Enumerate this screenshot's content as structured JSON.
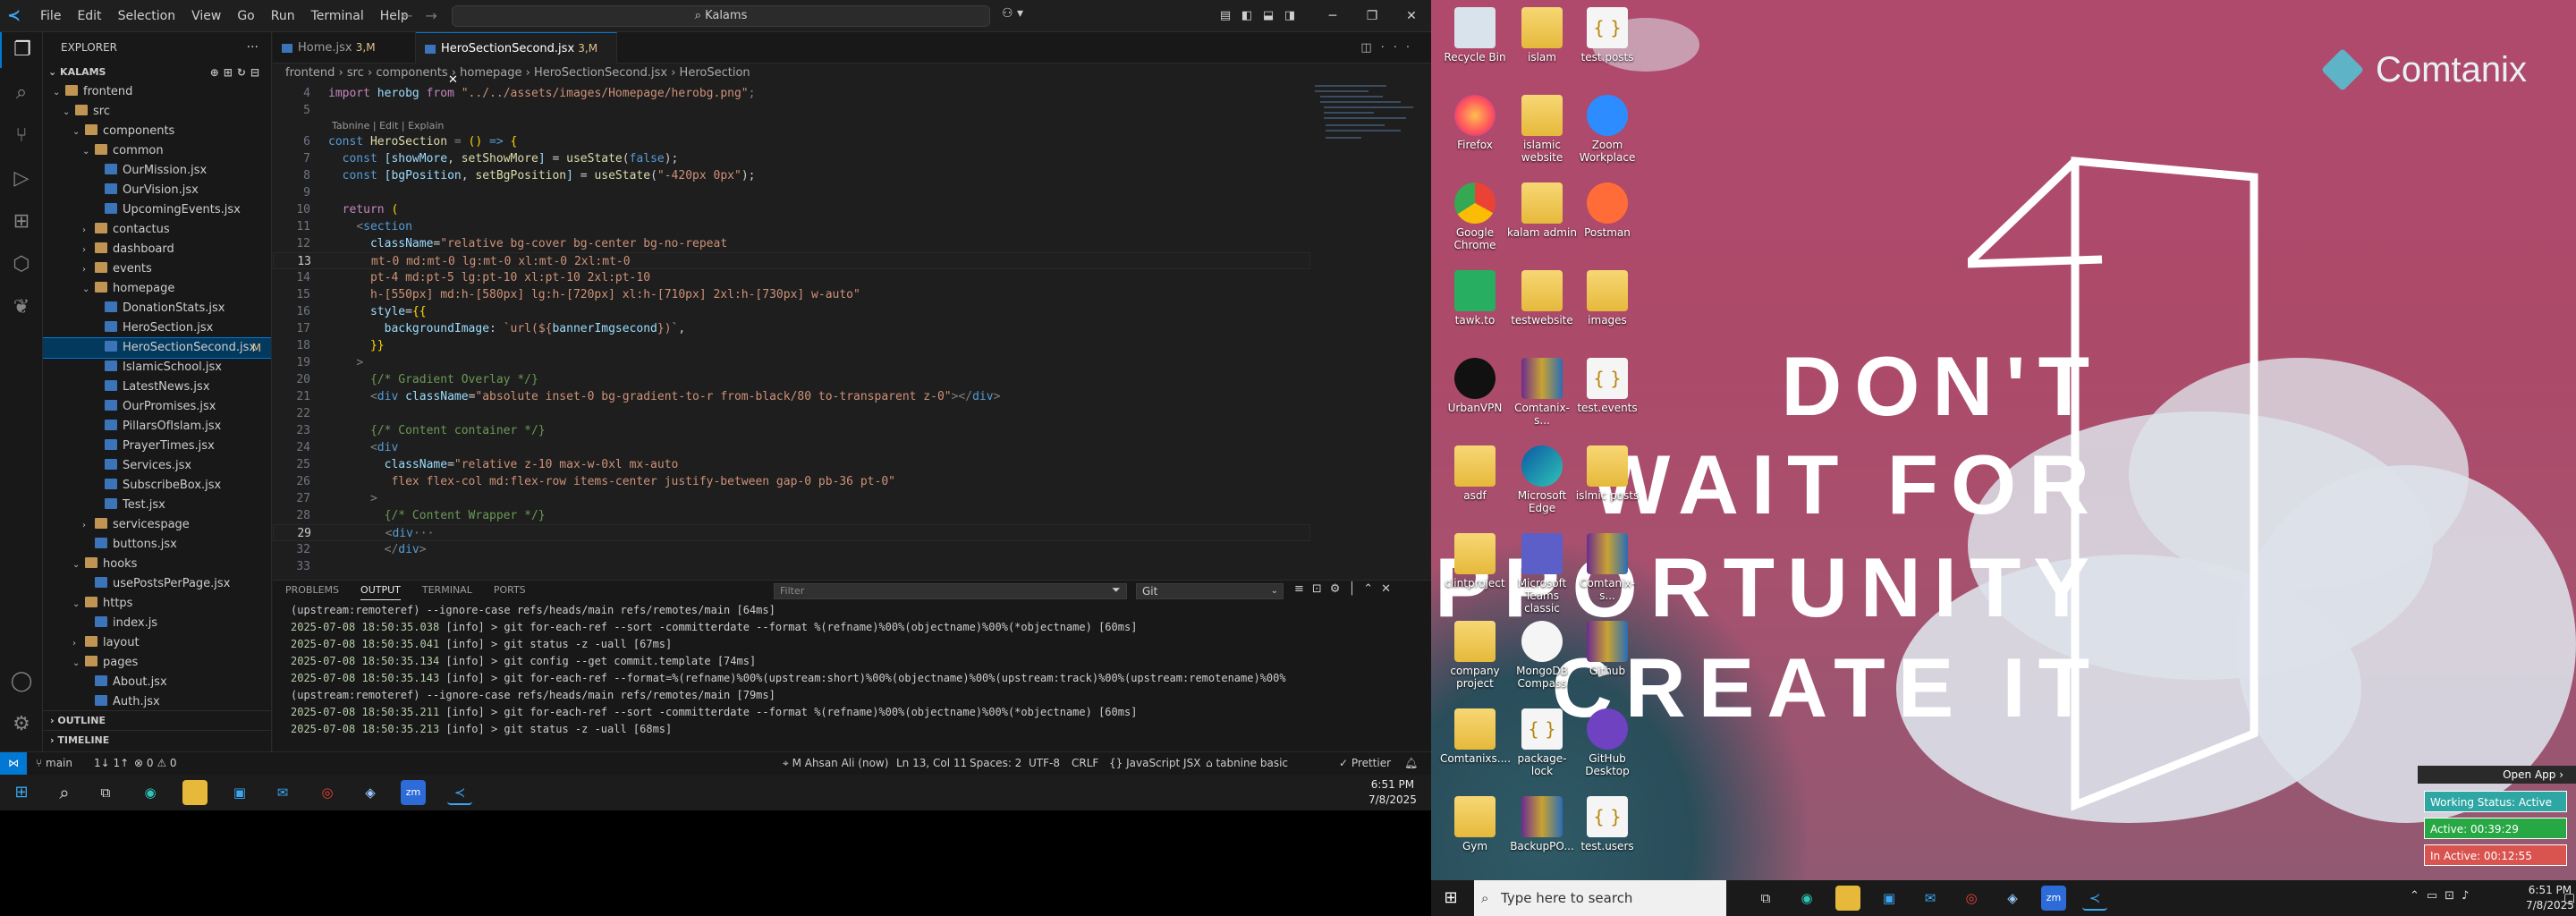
{
  "vscode": {
    "menu": [
      "File",
      "Edit",
      "Selection",
      "View",
      "Go",
      "Run",
      "Terminal",
      "Help"
    ],
    "search": "Kalams",
    "explorer_title": "EXPLORER",
    "root": "KALAMS",
    "tree": [
      {
        "label": "frontend",
        "type": "folder",
        "depth": 1,
        "open": true
      },
      {
        "label": "src",
        "type": "folder",
        "depth": 2,
        "open": true
      },
      {
        "label": "components",
        "type": "folder",
        "depth": 3,
        "open": true
      },
      {
        "label": "common",
        "type": "folder",
        "depth": 4,
        "open": true
      },
      {
        "label": "OurMission.jsx",
        "type": "file",
        "depth": 5
      },
      {
        "label": "OurVision.jsx",
        "type": "file",
        "depth": 5
      },
      {
        "label": "UpcomingEvents.jsx",
        "type": "file",
        "depth": 5
      },
      {
        "label": "contactus",
        "type": "folder",
        "depth": 4,
        "open": false
      },
      {
        "label": "dashboard",
        "type": "folder",
        "depth": 4,
        "open": false
      },
      {
        "label": "events",
        "type": "folder",
        "depth": 4,
        "open": false
      },
      {
        "label": "homepage",
        "type": "folder",
        "depth": 4,
        "open": true
      },
      {
        "label": "DonationStats.jsx",
        "type": "file",
        "depth": 5
      },
      {
        "label": "HeroSection.jsx",
        "type": "file",
        "depth": 5
      },
      {
        "label": "HeroSectionSecond.jsx",
        "type": "file",
        "depth": 5,
        "selected": true,
        "mod": "M"
      },
      {
        "label": "IslamicSchool.jsx",
        "type": "file",
        "depth": 5
      },
      {
        "label": "LatestNews.jsx",
        "type": "file",
        "depth": 5
      },
      {
        "label": "OurPromises.jsx",
        "type": "file",
        "depth": 5
      },
      {
        "label": "PillarsOfIslam.jsx",
        "type": "file",
        "depth": 5
      },
      {
        "label": "PrayerTimes.jsx",
        "type": "file",
        "depth": 5
      },
      {
        "label": "Services.jsx",
        "type": "file",
        "depth": 5
      },
      {
        "label": "SubscribeBox.jsx",
        "type": "file",
        "depth": 5
      },
      {
        "label": "Test.jsx",
        "type": "file",
        "depth": 5
      },
      {
        "label": "servicespage",
        "type": "folder",
        "depth": 4,
        "open": false
      },
      {
        "label": "buttons.jsx",
        "type": "file",
        "depth": 4
      },
      {
        "label": "hooks",
        "type": "folder",
        "depth": 3,
        "open": true
      },
      {
        "label": "usePostsPerPage.jsx",
        "type": "file",
        "depth": 4
      },
      {
        "label": "https",
        "type": "folder",
        "depth": 3,
        "open": true
      },
      {
        "label": "index.js",
        "type": "file",
        "depth": 4
      },
      {
        "label": "layout",
        "type": "folder",
        "depth": 3,
        "open": false
      },
      {
        "label": "pages",
        "type": "folder",
        "depth": 3,
        "open": true
      },
      {
        "label": "About.jsx",
        "type": "file",
        "depth": 4
      },
      {
        "label": "Auth.jsx",
        "type": "file",
        "depth": 4
      }
    ],
    "outline": "OUTLINE",
    "timeline": "TIMELINE",
    "tabs": [
      {
        "label": "Home.jsx",
        "mod": "M"
      },
      {
        "label": "HeroSectionSecond.jsx",
        "mod": "M",
        "active": true
      }
    ],
    "breadcrumb": [
      "frontend",
      "src",
      "components",
      "homepage",
      "HeroSectionSecond.jsx",
      "HeroSection"
    ],
    "code": [
      {
        "n": "4",
        "html": "<span class='kf'>import</span> <span class='v'>herobg</span> <span class='kf'>from</span> <span class='s'>\"../../assets/images/Homepage/herobg.png\"</span><span class='p'>;</span>"
      },
      {
        "n": "5",
        "html": ""
      },
      {
        "hint": "Tabnine | Edit | Explain"
      },
      {
        "n": "6",
        "html": "<span class='k'>const</span> <span class='fn'>HeroSection</span> <span class='p'>=</span> <span class='y'>()</span> <span class='k'>=&gt;</span> <span class='y'>{</span>"
      },
      {
        "n": "7",
        "html": "  <span class='k'>const</span> <span class='v'>[showMore</span>, <span class='fn'>setShowMore</span><span class='v'>]</span> = <span class='fn'>useState</span>(<span class='k'>false</span>);"
      },
      {
        "n": "8",
        "html": "  <span class='k'>const</span> <span class='v'>[bgPosition</span>, <span class='fn'>setBgPosition</span><span class='v'>]</span> = <span class='fn'>useState</span>(<span class='s'>\"-420px 0px\"</span>);"
      },
      {
        "n": "9",
        "html": ""
      },
      {
        "n": "10",
        "html": "  <span class='kf'>return</span> <span class='y'>(</span>"
      },
      {
        "n": "11",
        "html": "    <span class='p'>&lt;</span><span class='tg'>section</span>"
      },
      {
        "n": "12",
        "html": "      <span class='at'>className</span>=<span class='s'>\"relative bg-cover bg-center bg-no-repeat</span>"
      },
      {
        "n": "13",
        "html": "      <span class='s'>mt-0 md:mt-0 lg:mt-0 xl:mt-0 2xl:mt-0</span>",
        "cur": true
      },
      {
        "n": "14",
        "html": "      <span class='s'>pt-4 md:pt-5 lg:pt-10 xl:pt-10 2xl:pt-10</span>"
      },
      {
        "n": "15",
        "html": "      <span class='s'>h-[550px] md:h-[580px] lg:h-[720px] xl:h-[710px] 2xl:h-[730px] w-auto\"</span>"
      },
      {
        "n": "16",
        "html": "      <span class='at'>style</span>=<span class='y'>{{</span>"
      },
      {
        "n": "17",
        "html": "        <span class='v'>backgroundImage</span>: <span class='s'>`url(${</span><span class='v'>bannerImgsecond</span><span class='s'>})`</span>,"
      },
      {
        "n": "18",
        "html": "      <span class='y'>}}</span>"
      },
      {
        "n": "19",
        "html": "    <span class='p'>&gt;</span>"
      },
      {
        "n": "20",
        "html": "      <span class='c'>{/* Gradient Overlay */}</span>"
      },
      {
        "n": "21",
        "html": "      <span class='p'>&lt;</span><span class='tg'>div</span> <span class='at'>className</span>=<span class='s'>\"absolute inset-0 bg-gradient-to-r from-black/80 to-transparent z-0\"</span><span class='p'>&gt;&lt;/</span><span class='tg'>div</span><span class='p'>&gt;</span>"
      },
      {
        "n": "22",
        "html": ""
      },
      {
        "n": "23",
        "html": "      <span class='c'>{/* Content container */}</span>"
      },
      {
        "n": "24",
        "html": "      <span class='p'>&lt;</span><span class='tg'>div</span>"
      },
      {
        "n": "25",
        "html": "        <span class='at'>className</span>=<span class='s'>\"relative z-10 max-w-0xl mx-auto</span>"
      },
      {
        "n": "26",
        "html": "        <span class='s'> flex flex-col md:flex-row items-center justify-between gap-0 pb-36 pt-0\"</span>"
      },
      {
        "n": "27",
        "html": "      <span class='p'>&gt;</span>"
      },
      {
        "n": "28",
        "html": "        <span class='c'>{/* Content Wrapper */}</span>"
      },
      {
        "n": "29",
        "html": "        <span class='p'>&lt;</span><span class='tg'>div</span><span class='p'>···</span>",
        "cur": true
      },
      {
        "n": "32",
        "html": "        <span class='p'>&lt;/</span><span class='tg'>div</span><span class='p'>&gt;</span>"
      },
      {
        "n": "33",
        "html": ""
      }
    ],
    "panel_tabs": [
      "PROBLEMS",
      "OUTPUT",
      "TERMINAL",
      "PORTS"
    ],
    "panel_active": "OUTPUT",
    "filter_placeholder": "Filter",
    "output_channel": "Git",
    "output": [
      "(upstream:remoteref) --ignore-case refs/heads/main refs/remotes/main [64ms]",
      "2025-07-08 18:50:35.038 [info] > git for-each-ref --sort -committerdate --format %(refname)%00%(objectname)%00%(*objectname) [60ms]",
      "2025-07-08 18:50:35.041 [info] > git status -z -uall [67ms]",
      "2025-07-08 18:50:35.134 [info] > git config --get commit.template [74ms]",
      "2025-07-08 18:50:35.143 [info] > git for-each-ref --format=%(refname)%00%(upstream:short)%00%(objectname)%00%(upstream:track)%00%(upstream:remotename)%00%",
      "(upstream:remoteref) --ignore-case refs/heads/main refs/remotes/main [79ms]",
      "2025-07-08 18:50:35.211 [info] > git for-each-ref --sort -committerdate --format %(refname)%00%(objectname)%00%(*objectname) [60ms]",
      "2025-07-08 18:50:35.213 [info] > git status -z -uall [68ms]"
    ],
    "status": {
      "branch": "main",
      "sync": "1↓ 1↑",
      "problems": "⊗ 0 ⚠ 0",
      "author": "M Ahsan Ali (now)",
      "position": "Ln 13, Col 11",
      "spaces": "Spaces: 2",
      "encoding": "UTF-8",
      "eol": "CRLF",
      "language": "JavaScript JSX",
      "tabnine": "tabnine basic",
      "prettier": "Prettier"
    },
    "clock_time": "6:51 PM",
    "clock_date": "7/8/2025"
  },
  "desktop": {
    "brand": "Comtanix",
    "quote": [
      "DON'T",
      "WAIT FOR",
      "OPPORTUNITY",
      "CREATE IT"
    ],
    "icons": [
      {
        "label": "Recycle Bin",
        "kind": "bin"
      },
      {
        "label": "islam",
        "kind": "folder"
      },
      {
        "label": "test.posts",
        "kind": "json"
      },
      {
        "label": "Firefox",
        "kind": "firefox"
      },
      {
        "label": "islamic website",
        "kind": "folder"
      },
      {
        "label": "Zoom Workplace",
        "kind": "zoom"
      },
      {
        "label": "Google Chrome",
        "kind": "chrome"
      },
      {
        "label": "kalam admin",
        "kind": "folder"
      },
      {
        "label": "Postman",
        "kind": "postman"
      },
      {
        "label": "tawk.to",
        "kind": "tawk"
      },
      {
        "label": "testwebsite",
        "kind": "folder"
      },
      {
        "label": "images",
        "kind": "folder"
      },
      {
        "label": "UrbanVPN",
        "kind": "vpn"
      },
      {
        "label": "Comtanix-s...",
        "kind": "rar"
      },
      {
        "label": "test.events",
        "kind": "json"
      },
      {
        "label": "asdf",
        "kind": "folder"
      },
      {
        "label": "Microsoft Edge",
        "kind": "edge"
      },
      {
        "label": "islmic posts",
        "kind": "folder"
      },
      {
        "label": "clintproject",
        "kind": "folder"
      },
      {
        "label": "Microsoft Teams classic",
        "kind": "teams"
      },
      {
        "label": "Comtanix-s...",
        "kind": "rar"
      },
      {
        "label": "company project",
        "kind": "folder"
      },
      {
        "label": "MongoDB Compass",
        "kind": "mongo"
      },
      {
        "label": "Github",
        "kind": "rar"
      },
      {
        "label": "Comtanixs....",
        "kind": "folder"
      },
      {
        "label": "package-lock",
        "kind": "json"
      },
      {
        "label": "GitHub Desktop",
        "kind": "github"
      },
      {
        "label": "Gym",
        "kind": "folder"
      },
      {
        "label": "BackupPO...",
        "kind": "rar"
      },
      {
        "label": "test.users",
        "kind": "json"
      }
    ],
    "open_app": "Open App ›",
    "working": "Working Status: Active",
    "active": "Active: 00:39:29",
    "inactive": "In Active: 00:12:55",
    "search_placeholder": "Type here to search",
    "clock_time": "6:51 PM",
    "clock_date": "7/8/2025"
  }
}
